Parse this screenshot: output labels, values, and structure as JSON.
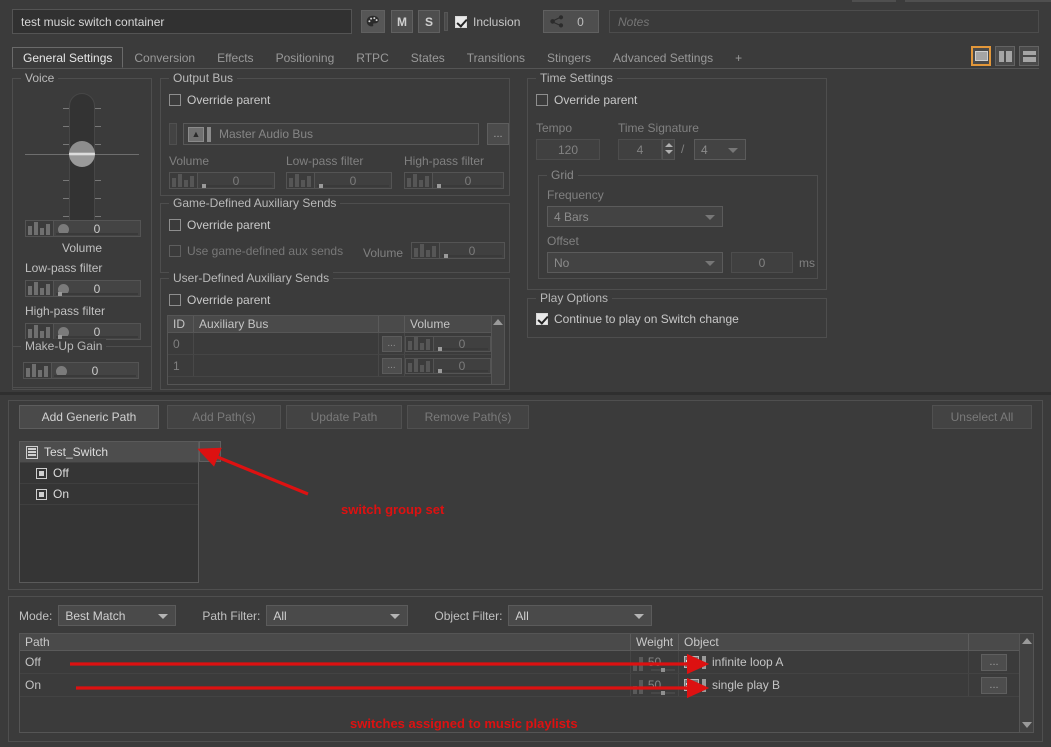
{
  "header": {
    "object_name": "test music switch container",
    "color_button": "palette-icon",
    "mute_label": "M",
    "solo_label": "S",
    "inclusion_label": "Inclusion",
    "share_count": "0",
    "notes_placeholder": "Notes"
  },
  "tabs": [
    {
      "label": "General Settings",
      "active": true
    },
    {
      "label": "Conversion",
      "active": false
    },
    {
      "label": "Effects",
      "active": false
    },
    {
      "label": "Positioning",
      "active": false
    },
    {
      "label": "RTPC",
      "active": false
    },
    {
      "label": "States",
      "active": false
    },
    {
      "label": "Transitions",
      "active": false
    },
    {
      "label": "Stingers",
      "active": false
    },
    {
      "label": "Advanced Settings",
      "active": false
    },
    {
      "label": "+",
      "active": false
    }
  ],
  "view_buttons": [
    {
      "name": "single-pane-view",
      "active": true
    },
    {
      "name": "vertical-split-view",
      "active": false
    },
    {
      "name": "horizontal-split-view",
      "active": false
    }
  ],
  "voice": {
    "title": "Voice",
    "volume_label": "Volume",
    "volume_value": "0",
    "lowpass_label": "Low-pass filter",
    "lowpass_value": "0",
    "highpass_label": "High-pass filter",
    "highpass_value": "0",
    "makeup_title": "Make-Up Gain",
    "makeup_value": "0"
  },
  "output_bus": {
    "title": "Output Bus",
    "override_label": "Override parent",
    "bus_name": "Master Audio Bus",
    "browse_label": "...",
    "volume_label": "Volume",
    "volume_value": "0",
    "lowpass_label": "Low-pass filter",
    "lowpass_value": "0",
    "highpass_label": "High-pass filter",
    "highpass_value": "0"
  },
  "game_defined_aux": {
    "title": "Game-Defined Auxiliary Sends",
    "override_label": "Override parent",
    "use_label": "Use game-defined aux sends",
    "volume_label": "Volume",
    "volume_value": "0"
  },
  "user_defined_aux": {
    "title": "User-Defined Auxiliary Sends",
    "override_label": "Override parent",
    "columns": [
      "ID",
      "Auxiliary Bus",
      "",
      "Volume"
    ],
    "rows": [
      {
        "id": "0",
        "bus": "",
        "dots": "...",
        "volume": "0"
      },
      {
        "id": "1",
        "bus": "",
        "dots": "...",
        "volume": "0"
      }
    ]
  },
  "time_settings": {
    "title": "Time Settings",
    "override_label": "Override parent",
    "tempo_label": "Tempo",
    "tempo_value": "120",
    "time_signature_label": "Time Signature",
    "signature_numerator": "4",
    "signature_separator": "/",
    "signature_denominator": "4",
    "grid_title": "Grid",
    "frequency_label": "Frequency",
    "frequency_value": "4 Bars",
    "offset_label": "Offset",
    "offset_value": "No",
    "offset_ms_value": "0",
    "offset_unit": "ms"
  },
  "play_options": {
    "title": "Play Options",
    "continue_label": "Continue to play on Switch change",
    "continue_checked": true
  },
  "path_toolbar": {
    "buttons": [
      {
        "label": "Add Generic Path",
        "enabled": true
      },
      {
        "label": "Add Path(s)",
        "enabled": false
      },
      {
        "label": "Update Path",
        "enabled": false
      },
      {
        "label": "Remove Path(s)",
        "enabled": false
      }
    ],
    "unselect_all": "Unselect All"
  },
  "switch_tree": {
    "group_name": "Test_Switch",
    "expand_label": ">>",
    "children": [
      {
        "label": "Off"
      },
      {
        "label": "On"
      }
    ]
  },
  "filters": {
    "mode_label": "Mode:",
    "mode_value": "Best Match",
    "path_filter_label": "Path Filter:",
    "path_filter_value": "All",
    "object_filter_label": "Object Filter:",
    "object_filter_value": "All"
  },
  "assignment_table": {
    "columns": [
      "Path",
      "Weight",
      "Object",
      ""
    ],
    "rows": [
      {
        "path": "Off",
        "weight": "50",
        "object": "infinite loop A",
        "dots": "..."
      },
      {
        "path": "On",
        "weight": "50",
        "object": "single play B",
        "dots": "..."
      }
    ]
  },
  "annotations": [
    {
      "text": "switch group set",
      "color": "#dd1111"
    },
    {
      "text": "switches assigned to music playlists",
      "color": "#dd1111"
    }
  ]
}
